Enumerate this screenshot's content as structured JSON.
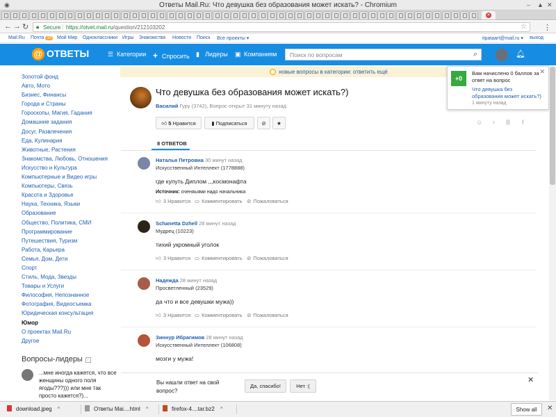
{
  "window": {
    "title": "Ответы Mail.Ru: Что девушка без образования может искать? - Chromium"
  },
  "toolbar": {
    "secure_label": "Secure",
    "url_host": "https://otvet.mail.ru",
    "url_path": "/question/212103202"
  },
  "portal_nav": {
    "items": [
      "Mail.Ru",
      "Почта",
      "Мой Мир",
      "Одноклассники",
      "Игры",
      "Знакомства",
      "Новости",
      "Поиск",
      "Все проекты ▾"
    ],
    "mail_badge": "10",
    "user_email": "itpataart@mail.ru ▾",
    "logout": "выход"
  },
  "header": {
    "logo_text": "ОТВЕТЫ",
    "nav": [
      "Категории",
      "Спросить",
      "Лидеры",
      "Компаниям"
    ],
    "search_placeholder": "Поиск по вопросам"
  },
  "sidebar": {
    "categories": [
      "Золотой фонд",
      "Авто, Мото",
      "Бизнес, Финансы",
      "Города и Страны",
      "Гороскопы, Магия, Гадания",
      "Домашние задания",
      "Досуг, Развлечения",
      "Еда, Кулинария",
      "Животные, Растения",
      "Знакомства, Любовь, Отношения",
      "Искусство и Культура",
      "Компьютерные и Видео игры",
      "Компьютеры, Связь",
      "Красота и Здоровье",
      "Наука, Техника, Языки",
      "Образование",
      "Общество, Политика, СМИ",
      "Программирование",
      "Путешествия, Туризм",
      "Работа, Карьера",
      "Семья, Дом, Дети",
      "Спорт",
      "Стиль, Мода, Звезды",
      "Товары и Услуги",
      "Философия, Непознанное",
      "Фотография, Видеосъемка",
      "Юридическая консультация",
      "Юмор",
      "О проектах Mail.Ru",
      "Другое"
    ],
    "active": "Юмор",
    "leaders_title": "Вопросы-лидеры",
    "leader_question": "...мне иногда кажется, что все женщины одного поля ягоды???))) или мне так просто кажется?)..."
  },
  "notice": {
    "text": "новые вопросы в категории: ответить ещё"
  },
  "question": {
    "title": "Что девушка без образования может искать?)",
    "author": "Василий",
    "meta": " Гуру (3742), Вопрос открыт 31 минуту назад",
    "like_count": "5",
    "like_label": "Нравится",
    "subscribe_label": "Подписаться"
  },
  "answers_tab": "8 ОТВЕТОВ",
  "answers": [
    {
      "name": "Наталья Петровна",
      "time": " 30 минут назад",
      "rank": "Искусственный Интеллект (1778888)",
      "text": "где купуть Диплом ,,,космонафта",
      "source_label": "Источник:",
      "source": " оченяьями надо начальника",
      "likes": "3 Нравится",
      "comment": "Комментировать",
      "report": "Пожаловаться"
    },
    {
      "name": "Schanetta Dzhell",
      "time": " 28 минут назад",
      "rank": "Мудрец (10223)",
      "text": "тихий укромный уголок",
      "likes": "3 Нравится",
      "comment": "Комментировать",
      "report": "Пожаловаться"
    },
    {
      "name": "Надежда",
      "time": " 28 минут назад",
      "rank": "Просветленный (23529)",
      "text": "да что и все девушки мужа))",
      "likes": "3 Нравится",
      "comment": "Комментировать",
      "report": "Пожаловаться"
    },
    {
      "name": "Зиннур Ибрагимов",
      "time": " 28 минут назад",
      "rank": "Искусственный Интеллект (106808)",
      "text": "мозги у мужа!"
    }
  ],
  "toast": {
    "points": "+0",
    "message": "Вам начислено 0 баллов за ответ на вопрос",
    "link": "Что девушка без образования может искать?)",
    "time": "1 минуту назад"
  },
  "feedback": {
    "question": "Вы нашли ответ на свой вопрос?",
    "yes": "Да, спасибо!",
    "no": "Нет :("
  },
  "downloads": {
    "items": [
      "download.jpeg",
      "Ответы Mai....html",
      "firefox-4....tar.bz2"
    ],
    "show_all": "Show all"
  },
  "colors": {
    "brand_blue": "#168de2",
    "link": "#1e5eb0",
    "accent_orange": "#ff9e00",
    "toast_green": "#36a941"
  }
}
